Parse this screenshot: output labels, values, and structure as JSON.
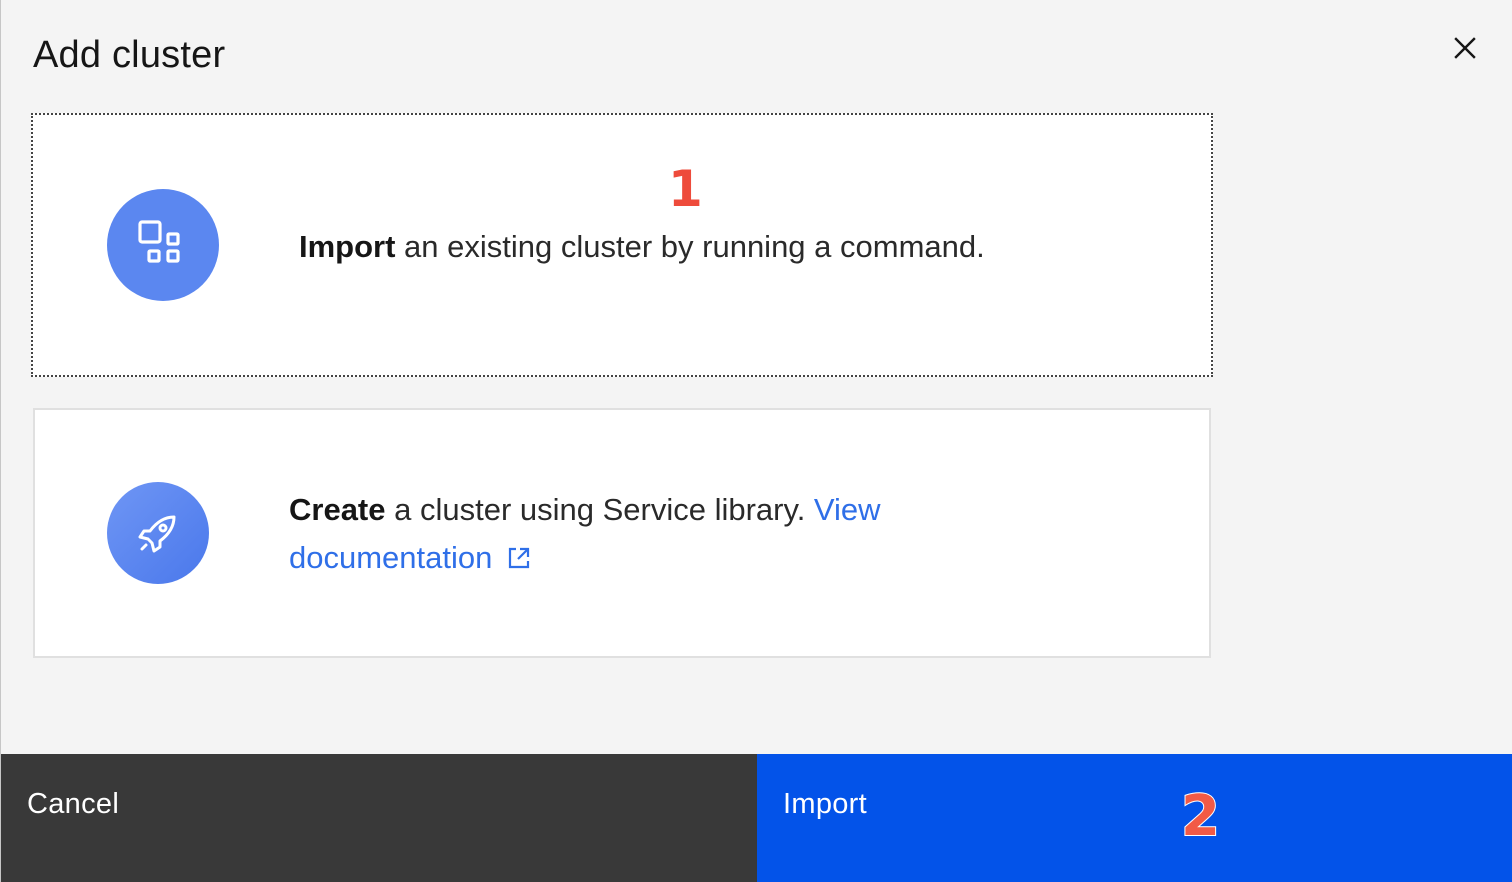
{
  "modal": {
    "title": "Add cluster",
    "close_label": "×"
  },
  "tiles": {
    "import": {
      "bold": "Import",
      "text": " an existing cluster by running a command."
    },
    "create": {
      "bold": "Create",
      "text": " a cluster using Service library. ",
      "link_text": "View documentation"
    }
  },
  "annotations": {
    "badge_1": "1",
    "badge_2": "2"
  },
  "footer": {
    "cancel_label": "Cancel",
    "primary_label": "Import"
  },
  "colors": {
    "accent": "#0353e9",
    "icon_circle": "#5b87f0",
    "link": "#2f6fe8",
    "cancel_bg": "#393939",
    "annotation": "#ee4b3b"
  },
  "icons": {
    "close": "close-icon",
    "import_tile": "cluster-grid-icon",
    "create_tile": "rocket-icon",
    "external_link": "launch-icon"
  }
}
